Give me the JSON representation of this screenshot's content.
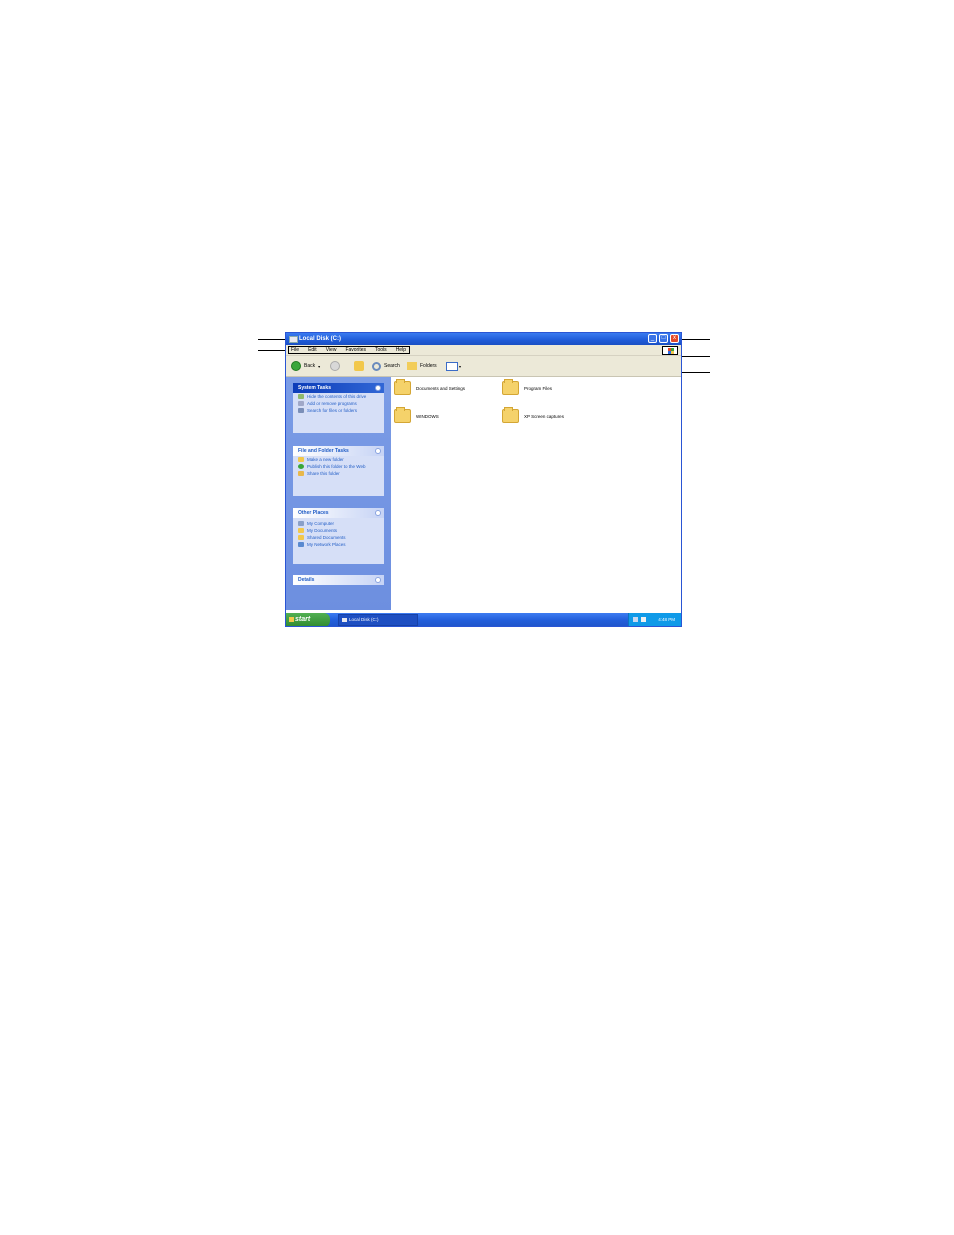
{
  "window": {
    "title": "Local Disk (C:)",
    "menu": [
      "File",
      "Edit",
      "View",
      "Favorites",
      "Tools",
      "Help"
    ],
    "buttons": {
      "minimize": "_",
      "maximize": "□",
      "close": "x"
    }
  },
  "toolbar": {
    "back": "Back",
    "search": "Search",
    "folders": "Folders"
  },
  "left_pane": {
    "system_tasks": {
      "title": "System Tasks",
      "items": [
        "Hide the contents of this drive",
        "Add or remove programs",
        "Search for files or folders"
      ]
    },
    "file_folder_tasks": {
      "title": "File and Folder Tasks",
      "items": [
        "Make a new folder",
        "Publish this folder to the Web",
        "Share this folder"
      ]
    },
    "other_places": {
      "title": "Other Places",
      "items": [
        "My Computer",
        "My Documents",
        "Shared Documents",
        "My Network Places"
      ]
    },
    "details": {
      "title": "Details"
    }
  },
  "folders": [
    "Documents and Settings",
    "Program Files",
    "WINDOWS",
    "XP Screen captures"
  ],
  "taskbar": {
    "start": "start",
    "task_button": "Local Disk (C:)",
    "clock": "4:48 PM"
  },
  "colors": {
    "title_bar": "#1f5bd8",
    "task_pane": "#7b9ce6",
    "start_button": "#3a9a3a",
    "close_button": "#e24a2a"
  }
}
